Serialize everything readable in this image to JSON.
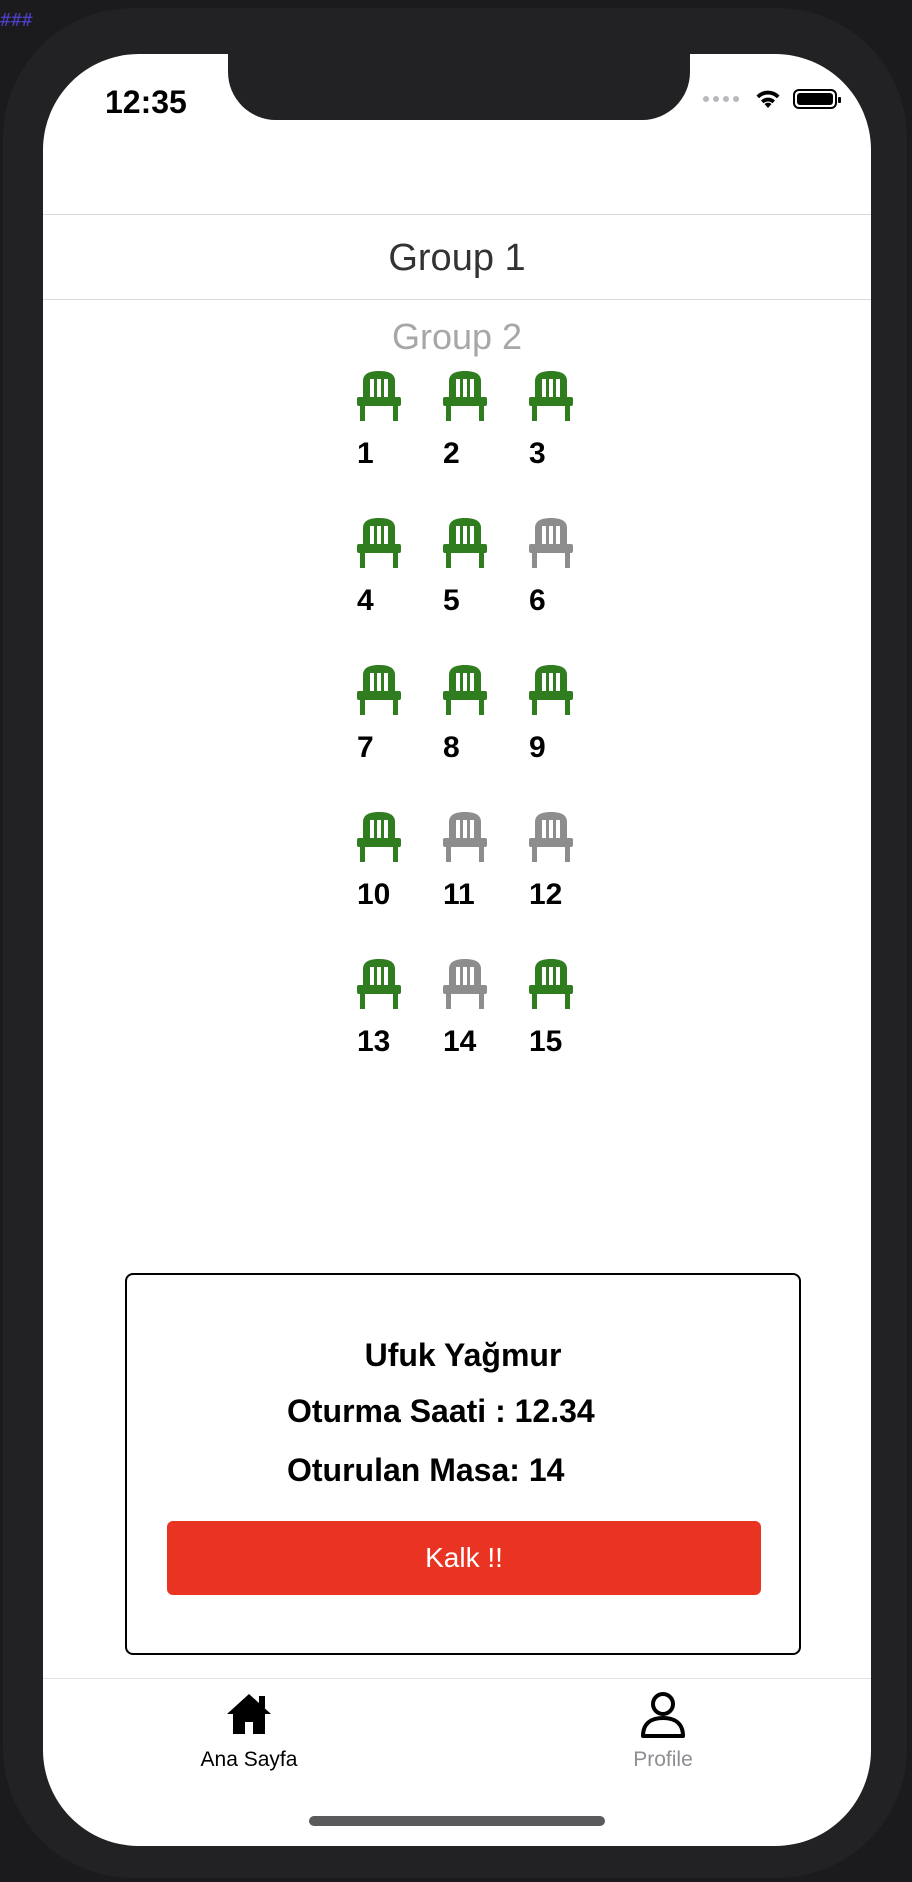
{
  "status": {
    "time": "12:35"
  },
  "picker": {
    "selected": "Group 1",
    "next": "Group 2"
  },
  "colors": {
    "available": "#2f7d1e",
    "occupied": "#8d8d8d",
    "accent": "#e93423"
  },
  "seats": [
    {
      "number": "1",
      "state": "available"
    },
    {
      "number": "2",
      "state": "available"
    },
    {
      "number": "3",
      "state": "available"
    },
    {
      "number": "4",
      "state": "available"
    },
    {
      "number": "5",
      "state": "available"
    },
    {
      "number": "6",
      "state": "occupied"
    },
    {
      "number": "7",
      "state": "available"
    },
    {
      "number": "8",
      "state": "available"
    },
    {
      "number": "9",
      "state": "available"
    },
    {
      "number": "10",
      "state": "available"
    },
    {
      "number": "11",
      "state": "occupied"
    },
    {
      "number": "12",
      "state": "occupied"
    },
    {
      "number": "13",
      "state": "available"
    },
    {
      "number": "14",
      "state": "occupied"
    },
    {
      "number": "15",
      "state": "available"
    }
  ],
  "card": {
    "name": "Ufuk Yağmur",
    "seat_time": "Oturma Saati : 12.34",
    "table": "Oturulan Masa: 14",
    "button": "Kalk !!"
  },
  "tabs": {
    "home": {
      "label": "Ana Sayfa",
      "icon": "home-icon"
    },
    "profile": {
      "label": "Profile",
      "icon": "user-icon"
    }
  }
}
